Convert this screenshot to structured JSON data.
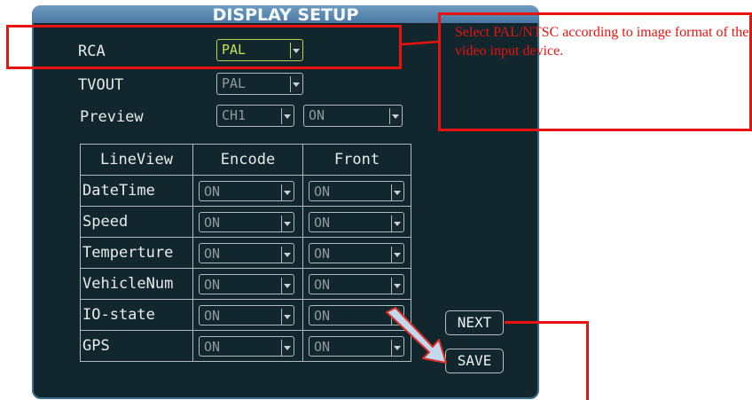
{
  "screen": {
    "title": "DISPLAY SETUP",
    "rca": {
      "label": "RCA",
      "value": "PAL"
    },
    "tvout": {
      "label": "TVOUT",
      "value": "PAL"
    },
    "preview": {
      "label": "Preview",
      "channel": "CH1",
      "state": "ON"
    },
    "table": {
      "headers": [
        "LineView",
        "Encode",
        "Front"
      ],
      "rows": [
        {
          "label": "DateTime",
          "encode": "ON",
          "front": "ON"
        },
        {
          "label": "Speed",
          "encode": "ON",
          "front": "ON"
        },
        {
          "label": "Temperture",
          "encode": "ON",
          "front": "ON"
        },
        {
          "label": "VehicleNum",
          "encode": "ON",
          "front": "ON"
        },
        {
          "label": "IO-state",
          "encode": "ON",
          "front": "ON"
        },
        {
          "label": "GPS",
          "encode": "ON",
          "front": "ON"
        }
      ]
    },
    "buttons": {
      "next": "NEXT",
      "save": "SAVE"
    }
  },
  "annotation": {
    "note": "Select PAL/NTSC according to image format of the video input device.",
    "color": "#e8120e"
  }
}
